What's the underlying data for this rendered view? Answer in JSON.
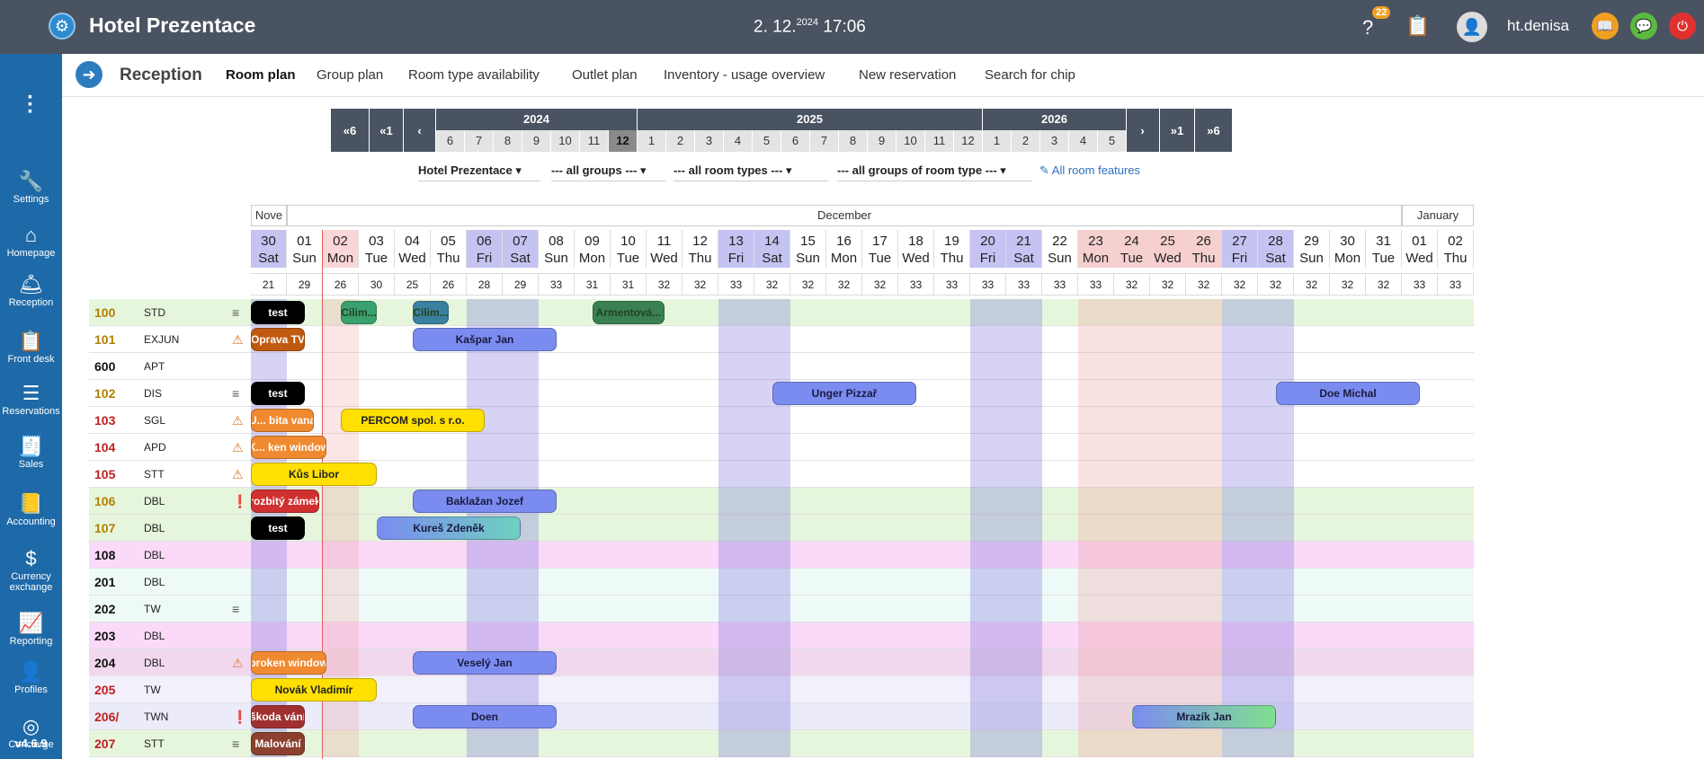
{
  "app": {
    "title": "Hotel Prezentace",
    "date_main": "2. 12.",
    "date_year": "2024",
    "time": "17:06",
    "notif_count": "22",
    "user": "ht.denisa",
    "version": "v4.6.9"
  },
  "sidebar": {
    "items": [
      {
        "label": "Settings",
        "icon": "wrench-icon"
      },
      {
        "label": "Homepage",
        "icon": "home-icon"
      },
      {
        "label": "Reception",
        "icon": "bell-icon"
      },
      {
        "label": "Front desk",
        "icon": "clipboard-icon"
      },
      {
        "label": "Reservations",
        "icon": "sliders-icon"
      },
      {
        "label": "Sales",
        "icon": "register-icon"
      },
      {
        "label": "Accounting",
        "icon": "ledger-icon"
      },
      {
        "label": "Currency",
        "label2": "exchange",
        "icon": "currency-icon"
      },
      {
        "label": "Reporting",
        "icon": "chart-icon"
      },
      {
        "label": "Profiles",
        "icon": "profile-icon"
      },
      {
        "label": "Concierge",
        "icon": "concierge-icon"
      }
    ]
  },
  "subnav": {
    "section": "Reception",
    "tabs": [
      {
        "label": "Room plan",
        "active": true
      },
      {
        "label": "Group plan"
      },
      {
        "label": "Room type availability"
      },
      {
        "label": "Outlet plan"
      },
      {
        "label": "Inventory - usage overview"
      },
      {
        "label": "New reservation"
      },
      {
        "label": "Search for chip"
      }
    ]
  },
  "timeline": {
    "back6": "«6",
    "back1": "«1",
    "fwd1": "»1",
    "fwd6": "»6",
    "years": [
      "2024",
      "2025",
      "2026"
    ],
    "months2024": [
      "6",
      "7",
      "8",
      "9",
      "10",
      "11",
      "12"
    ],
    "months2025": [
      "1",
      "2",
      "3",
      "4",
      "5",
      "6",
      "7",
      "8",
      "9",
      "10",
      "11",
      "12"
    ],
    "months2026": [
      "1",
      "2",
      "3",
      "4",
      "5"
    ],
    "selected": "12"
  },
  "filters": {
    "hotel": "Hotel Prezentace",
    "groups": "--- all groups ---",
    "room_types": "--- all room types ---",
    "room_type_groups": "--- all groups of room type ---",
    "features": "All room features"
  },
  "months_header": [
    "Nove",
    "December",
    "January"
  ],
  "days": [
    {
      "d": "30",
      "w": "Sat",
      "o": "21"
    },
    {
      "d": "01",
      "w": "Sun",
      "o": "29"
    },
    {
      "d": "02",
      "w": "Mon",
      "o": "26"
    },
    {
      "d": "03",
      "w": "Tue",
      "o": "30"
    },
    {
      "d": "04",
      "w": "Wed",
      "o": "25"
    },
    {
      "d": "05",
      "w": "Thu",
      "o": "26"
    },
    {
      "d": "06",
      "w": "Fri",
      "o": "28"
    },
    {
      "d": "07",
      "w": "Sat",
      "o": "29"
    },
    {
      "d": "08",
      "w": "Sun",
      "o": "33"
    },
    {
      "d": "09",
      "w": "Mon",
      "o": "31"
    },
    {
      "d": "10",
      "w": "Tue",
      "o": "31"
    },
    {
      "d": "11",
      "w": "Wed",
      "o": "32"
    },
    {
      "d": "12",
      "w": "Thu",
      "o": "32"
    },
    {
      "d": "13",
      "w": "Fri",
      "o": "33"
    },
    {
      "d": "14",
      "w": "Sat",
      "o": "32"
    },
    {
      "d": "15",
      "w": "Sun",
      "o": "32"
    },
    {
      "d": "16",
      "w": "Mon",
      "o": "32"
    },
    {
      "d": "17",
      "w": "Tue",
      "o": "32"
    },
    {
      "d": "18",
      "w": "Wed",
      "o": "33"
    },
    {
      "d": "19",
      "w": "Thu",
      "o": "33"
    },
    {
      "d": "20",
      "w": "Fri",
      "o": "33"
    },
    {
      "d": "21",
      "w": "Sat",
      "o": "33"
    },
    {
      "d": "22",
      "w": "Sun",
      "o": "33"
    },
    {
      "d": "23",
      "w": "Mon",
      "o": "33"
    },
    {
      "d": "24",
      "w": "Tue",
      "o": "32"
    },
    {
      "d": "25",
      "w": "Wed",
      "o": "32"
    },
    {
      "d": "26",
      "w": "Thu",
      "o": "32"
    },
    {
      "d": "27",
      "w": "Fri",
      "o": "32"
    },
    {
      "d": "28",
      "w": "Sat",
      "o": "32"
    },
    {
      "d": "29",
      "w": "Sun",
      "o": "32"
    },
    {
      "d": "30",
      "w": "Mon",
      "o": "32"
    },
    {
      "d": "31",
      "w": "Tue",
      "o": "32"
    },
    {
      "d": "01",
      "w": "Wed",
      "o": "33"
    },
    {
      "d": "02",
      "w": "Thu",
      "o": "33"
    }
  ],
  "rooms": [
    {
      "no": "100",
      "type": "STD",
      "icon": "menu",
      "color": "#b08000",
      "bg": "#e6f6dc"
    },
    {
      "no": "101",
      "type": "EXJUN",
      "icon": "warn",
      "color": "#b08000",
      "bg": "#ffffff"
    },
    {
      "no": "600",
      "type": "APT",
      "icon": "",
      "color": "#111111",
      "bg": "#ffffff"
    },
    {
      "no": "102",
      "type": "DIS",
      "icon": "menu",
      "color": "#b08000",
      "bg": "#ffffff"
    },
    {
      "no": "103",
      "type": "SGL",
      "icon": "warn",
      "color": "#c02020",
      "bg": "#ffffff"
    },
    {
      "no": "104",
      "type": "APD",
      "icon": "warn",
      "color": "#c02020",
      "bg": "#ffffff"
    },
    {
      "no": "105",
      "type": "STT",
      "icon": "warn",
      "color": "#c02020",
      "bg": "#ffffff"
    },
    {
      "no": "106",
      "type": "DBL",
      "icon": "err",
      "color": "#b08000",
      "bg": "#e6f6dc"
    },
    {
      "no": "107",
      "type": "DBL",
      "icon": "",
      "color": "#b08000",
      "bg": "#e6f6dc"
    },
    {
      "no": "108",
      "type": "DBL",
      "icon": "",
      "color": "#111111",
      "bg": "#fadaf8"
    },
    {
      "no": "201",
      "type": "DBL",
      "icon": "",
      "color": "#111111",
      "bg": "#eefaf8"
    },
    {
      "no": "202",
      "type": "TW",
      "icon": "menu",
      "color": "#111111",
      "bg": "#eefaf8"
    },
    {
      "no": "203",
      "type": "DBL",
      "icon": "",
      "color": "#111111",
      "bg": "#fadaf8"
    },
    {
      "no": "204",
      "type": "DBL",
      "icon": "warn",
      "color": "#111111",
      "bg": "#f2d8ee"
    },
    {
      "no": "205",
      "type": "TW",
      "icon": "",
      "color": "#c02020",
      "bg": "#f2f0fb"
    },
    {
      "no": "206/",
      "type": "TWN",
      "icon": "err",
      "color": "#c02020",
      "bg": "#ebebfa"
    },
    {
      "no": "207",
      "type": "STT",
      "icon": "menu",
      "color": "#c02020",
      "bg": "#e6f6dc"
    }
  ],
  "bookings": [
    {
      "row": 0,
      "start": 0,
      "span": 1.5,
      "label": "test",
      "bg": "#000000",
      "fg": "#ffffff"
    },
    {
      "row": 0,
      "start": 2.5,
      "span": 1,
      "label": "Cilim...",
      "bg": "#3aa070",
      "fg": "#224422"
    },
    {
      "row": 0,
      "start": 4.5,
      "span": 1,
      "label": "Cilim...",
      "bg": "#3a80a0",
      "fg": "#224422"
    },
    {
      "row": 0,
      "start": 9.5,
      "span": 2,
      "label": "Armentová...",
      "bg": "#3a8050",
      "fg": "#224422"
    },
    {
      "row": 1,
      "start": 0,
      "span": 1.5,
      "label": "Oprava TV",
      "bg": "#c05a10",
      "fg": "#ffffff"
    },
    {
      "row": 1,
      "start": 4.5,
      "span": 4,
      "label": "Kašpar Jan",
      "bg": "#7b8cf0",
      "fg": "#1a1a40"
    },
    {
      "row": 3,
      "start": 0,
      "span": 1.5,
      "label": "test",
      "bg": "#000000",
      "fg": "#ffffff"
    },
    {
      "row": 3,
      "start": 14.5,
      "span": 4,
      "label": "Unger Pizzař",
      "bg": "#7b8cf0",
      "fg": "#1a1a40"
    },
    {
      "row": 3,
      "start": 28.5,
      "span": 4,
      "label": "Doe Michal",
      "bg": "#7b8cf0",
      "fg": "#1a1a40"
    },
    {
      "row": 4,
      "start": 0,
      "span": 1.75,
      "label": "Umyvadlo / bita vana",
      "short": "U... bita vana",
      "bg": "#f08a30",
      "fg": "#ffffff"
    },
    {
      "row": 4,
      "start": 2.5,
      "span": 4,
      "label": "PERCOM spol. s r.o.",
      "bg": "#ffe000",
      "fg": "#222222"
    },
    {
      "row": 5,
      "start": 0,
      "span": 2.1,
      "label": "K... ken window",
      "bg": "#f08a30",
      "fg": "#ffffff"
    },
    {
      "row": 6,
      "start": 0,
      "span": 3.5,
      "label": "Kůs Libor",
      "bg": "#ffe000",
      "fg": "#222222"
    },
    {
      "row": 7,
      "start": 0,
      "span": 1.9,
      "label": "rozbitý zámek",
      "bg": "#d03030",
      "fg": "#ffffff"
    },
    {
      "row": 7,
      "start": 4.5,
      "span": 4,
      "label": "Baklažan Jozef",
      "bg": "#7b8cf0",
      "fg": "#1a1a40"
    },
    {
      "row": 8,
      "start": 0,
      "span": 1.5,
      "label": "test",
      "bg": "#000000",
      "fg": "#ffffff"
    },
    {
      "row": 8,
      "start": 3.5,
      "span": 4,
      "label": "Kureš Zdeněk",
      "bg": "#7b8cf0",
      "fg": "#1a1a40"
    },
    {
      "row": 13,
      "start": 0,
      "span": 2.1,
      "label": "broken window",
      "bg": "#f08a30",
      "fg": "#ffffff"
    },
    {
      "row": 13,
      "start": 4.5,
      "span": 4,
      "label": "Veselý Jan",
      "bg": "#7b8cf0",
      "fg": "#1a1a40"
    },
    {
      "row": 14,
      "start": 0,
      "span": 3.5,
      "label": "Novák Vladimír",
      "bg": "#ffe000",
      "fg": "#222222"
    },
    {
      "row": 15,
      "start": 0,
      "span": 1.5,
      "label": "škoda vání",
      "bg": "#a03030",
      "fg": "#ffffff"
    },
    {
      "row": 15,
      "start": 4.5,
      "span": 4,
      "label": "Doen",
      "bg": "#7b8cf0",
      "fg": "#1a1a40"
    },
    {
      "row": 15,
      "start": 24.5,
      "span": 4,
      "label": "Mrazík Jan",
      "bg": "#7b8cf0",
      "fg": "#1a1a40"
    },
    {
      "row": 16,
      "start": 0,
      "span": 1.5,
      "label": "Malování",
      "bg": "#8b4030",
      "fg": "#ffffff"
    }
  ]
}
